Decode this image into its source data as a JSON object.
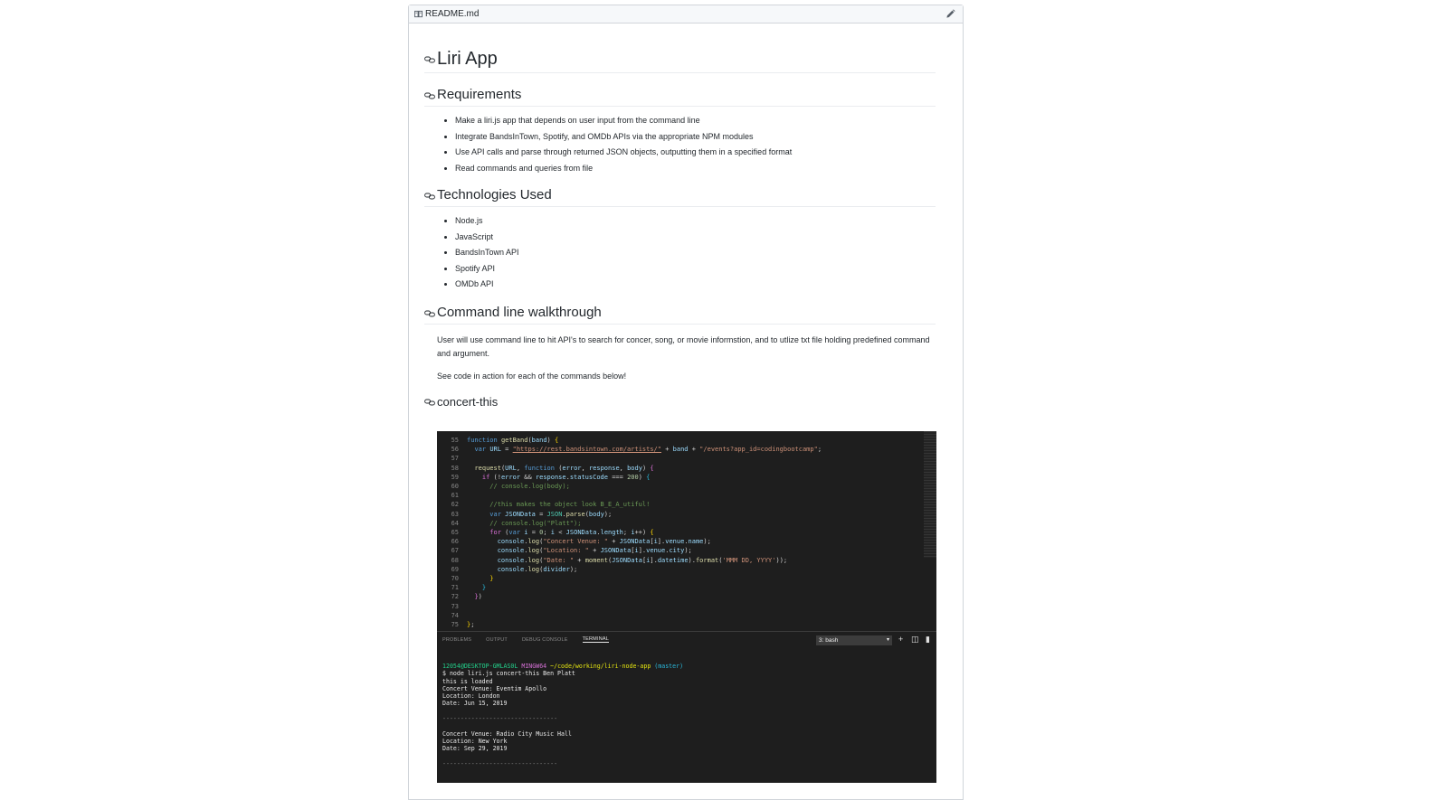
{
  "readme": {
    "filename": "README.md",
    "title": "Liri App",
    "requirements_heading": "Requirements",
    "requirements": [
      "Make a liri.js app that depends on user input from the command line",
      "Integrate BandsInTown, Spotify, and OMDb APIs via the appropriate NPM modules",
      "Use API calls and parse through returned JSON objects, outputting them in a specified format",
      "Read commands and queries from file"
    ],
    "tech_heading": "Technologies Used",
    "technologies": [
      "Node.js",
      "JavaScript",
      "BandsInTown API",
      "Spotify API",
      "OMDb API"
    ],
    "walkthrough_heading": "Command line walkthrough",
    "walkthrough_p1": "User will use command line to hit API's to search for concer, song, or movie informstion, and to utlize txt file holding predefined command and argument.",
    "walkthrough_p2": "See code in action for each of the commands below!",
    "concert_heading": "concert-this"
  },
  "editor": {
    "line_numbers": [
      "55",
      "56",
      "57",
      "58",
      "59",
      "60",
      "61",
      "62",
      "63",
      "64",
      "65",
      "66",
      "67",
      "68",
      "69",
      "70",
      "71",
      "72",
      "73",
      "74",
      "75"
    ]
  },
  "panel": {
    "tabs": [
      "PROBLEMS",
      "OUTPUT",
      "DEBUG CONSOLE",
      "TERMINAL"
    ],
    "active_tab": "TERMINAL",
    "shell": "3: bash"
  },
  "terminal": {
    "prompt_user": "12054@DESKTOP-GMLAS0L",
    "prompt_env": "MINGW64",
    "prompt_path": "~/code/working/liri-node-app",
    "prompt_branch": "(master)",
    "command": "$ node liri.js concert-this Ben Platt",
    "loaded": "this is loaded",
    "venue1": "Concert Venue: Eventim Apollo",
    "location1": "Location: London",
    "date1": "Date: Jun 15, 2019",
    "divider": "--------------------------------",
    "venue2": "Concert Venue: Radio City Music Hall",
    "location2": "Location: New York",
    "date2": "Date: Sep 29, 2019"
  }
}
